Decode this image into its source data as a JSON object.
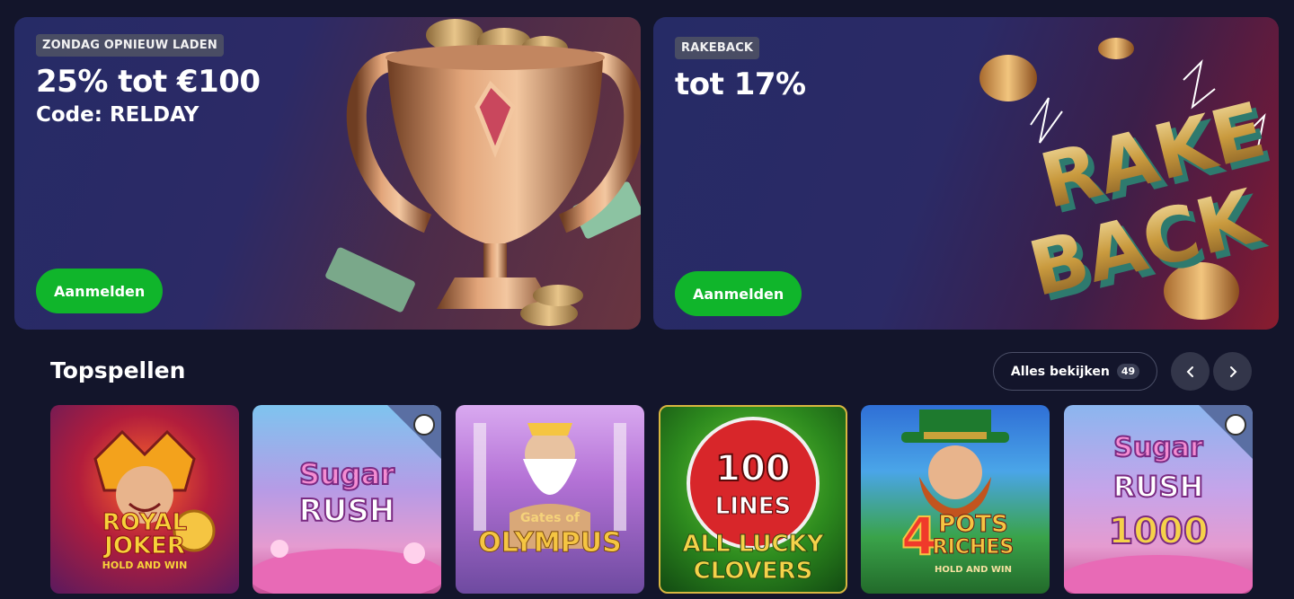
{
  "promos": [
    {
      "tag": "ZONDAG OPNIEUW LADEN",
      "headline": "25% tot €100",
      "subline": "Code: RELDAY",
      "cta": "Aanmelden"
    },
    {
      "tag": "RAKEBACK",
      "headline": "tot 17%",
      "art_text_1": "RAKE",
      "art_text_2": "BACK",
      "cta": "Aanmelden"
    }
  ],
  "top_games": {
    "title": "Topspellen",
    "view_all_label": "Alles bekijken",
    "count": "49",
    "games": [
      {
        "line1": "ROYAL",
        "line2": "JOKER",
        "line3": "HOLD AND WIN"
      },
      {
        "line1": "Sugar",
        "line2": "RUSH"
      },
      {
        "line1": "Gates of",
        "line2": "OLYMPUS"
      },
      {
        "line1": "100",
        "line2": "LINES",
        "line3": "ALL LUCKY",
        "line4": "CLOVERS"
      },
      {
        "line1": "4",
        "line2": "POTS",
        "line3": "RICHES",
        "line4": "HOLD AND WIN"
      },
      {
        "line1": "Sugar",
        "line2": "RUSH",
        "line3": "1000"
      }
    ]
  },
  "colors": {
    "background": "#13152b",
    "cta_green": "#10b52b",
    "nav_button": "#33364a"
  }
}
